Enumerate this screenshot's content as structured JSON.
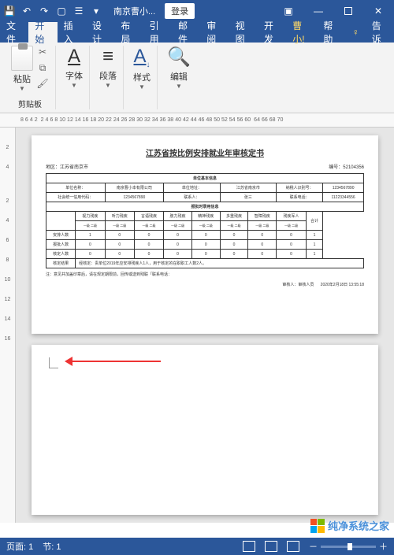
{
  "titlebar": {
    "doc_name": "南京曹小...",
    "login_btn": "登录"
  },
  "tabs": {
    "file": "文件",
    "home": "开始",
    "insert": "插入",
    "design": "设计",
    "layout": "布局",
    "references": "引用",
    "mailings": "邮件",
    "review": "审阅",
    "view": "视图",
    "developer": "开发",
    "cao": "曹小!",
    "help": "帮助",
    "tell": "告诉"
  },
  "ribbon": {
    "paste": "粘贴",
    "clipboard": "剪贴板",
    "font": "字体",
    "paragraph": "段落",
    "styles": "样式",
    "editing": "编辑"
  },
  "ruler_h": [
    "8",
    "6",
    "4",
    "2",
    "",
    "2",
    "4",
    "6",
    "8",
    "10",
    "12",
    "14",
    "16",
    "18",
    "20",
    "22",
    "24",
    "26",
    "28",
    "30",
    "32",
    "34",
    "36",
    "38",
    "40",
    "42",
    "44",
    "46",
    "48",
    "50",
    "52",
    "54",
    "56",
    "60",
    "",
    "64",
    "66",
    "68",
    "70"
  ],
  "ruler_v1": [
    "",
    "2",
    "4"
  ],
  "ruler_v2": [
    "",
    "2",
    "4",
    "6",
    "8",
    "10",
    "12",
    "14",
    "16"
  ],
  "document": {
    "title": "江苏省按比例安排就业年审核定书",
    "meta_left": "地区：江苏省南京市",
    "meta_right": "编号：52104356",
    "section1": "单位基本信息",
    "row1": {
      "h1": "单位名称：",
      "v1": "南京曹小本有限公司",
      "h2": "单位地址：",
      "v2": "江苏省南京市",
      "h3": "纳税人识别号：",
      "v3": "1234567890"
    },
    "row2": {
      "h1": "社会统一信用代码：",
      "v1": "1234567890",
      "h2": "联系人：",
      "v2": "张三",
      "h3": "联系电话：",
      "v3": "11223344556"
    },
    "section2": "报批时录用信息",
    "disability_headers": [
      "",
      "视力残疾",
      "听力残疾",
      "言语残疾",
      "肢力残疾",
      "精神残疾",
      "多重残疾",
      "智障残疾",
      "残疾军人",
      "合计"
    ],
    "sub_headers": [
      "一级",
      "二级"
    ],
    "row_labels": [
      "安排人数",
      "报批人数",
      "核定人数"
    ],
    "zero": "0",
    "one": "1",
    "total1": "1",
    "total2": "1",
    "total3": "1",
    "remark_label": "核定结果",
    "remark_text": "经核定：贵单位2019年应安排残疾人1人，用于核定的在职职工人数2人。",
    "note": "注：意见并加盖印章后，请在规定期限前，回传或送到残联「联系电话：",
    "signer": "审核人：审核人员",
    "date": "2020年2月18日 13:55:18"
  },
  "statusbar": {
    "page": "页面: 1",
    "section": "节: 1",
    "zoom_minus": "－",
    "zoom_plus": "＋"
  },
  "watermark": "纯净系统之家"
}
